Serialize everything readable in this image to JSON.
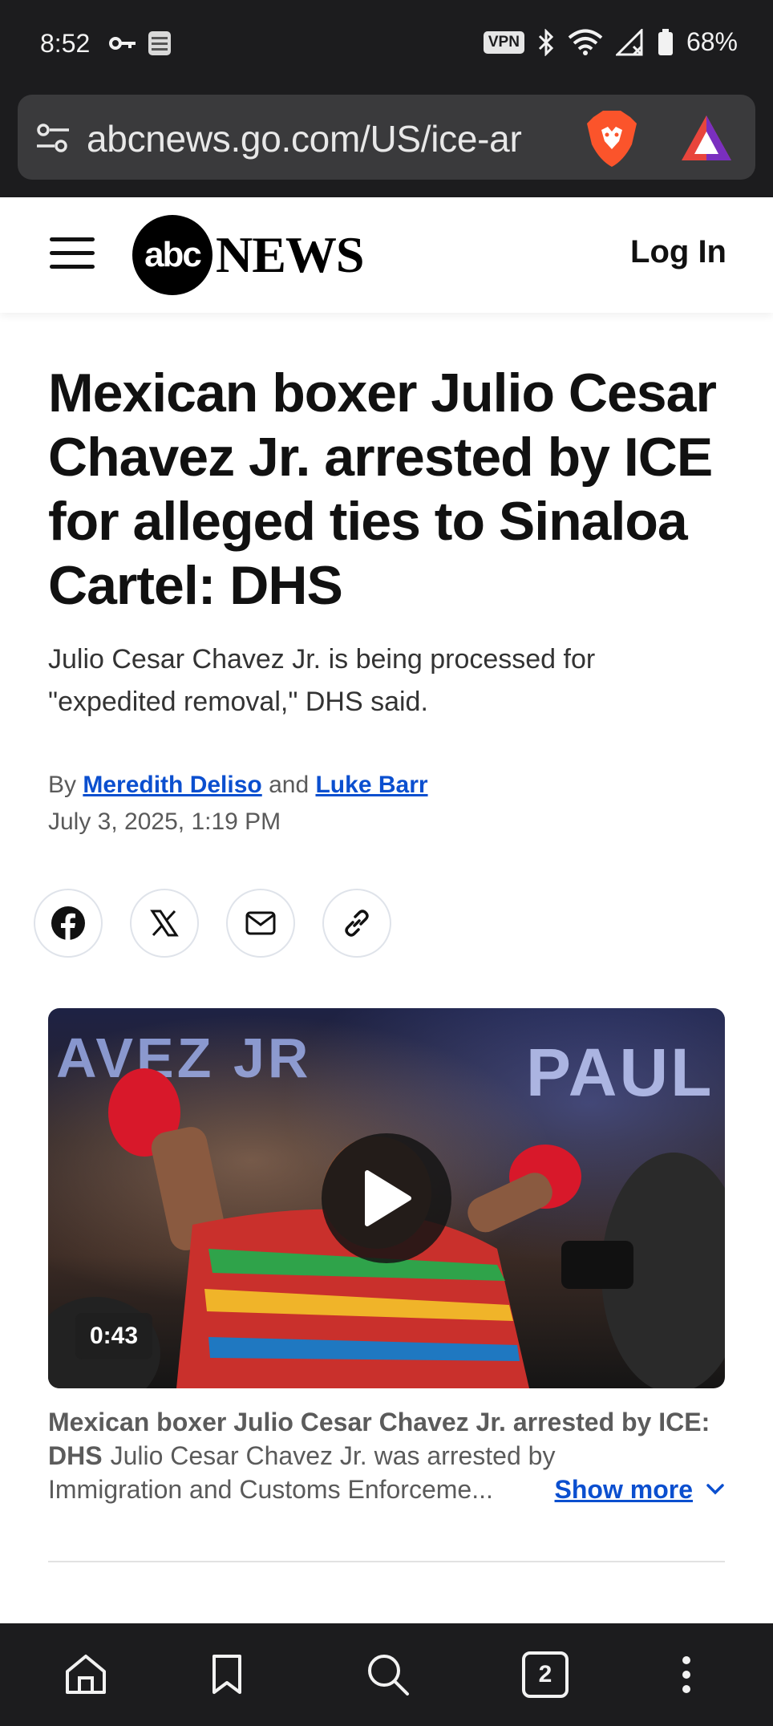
{
  "status_bar": {
    "time": "8:52",
    "vpn_label": "VPN",
    "battery": "68%",
    "icons": [
      "key-icon",
      "amazon-shopper-panel-icon",
      "bluetooth-icon",
      "wifi-icon",
      "signal-icon",
      "battery-icon"
    ]
  },
  "browser": {
    "url": "abcnews.go.com/US/ice-ar",
    "icons": [
      "site-settings-icon",
      "brave-shields-icon",
      "brave-rewards-icon"
    ],
    "tab_count": "2",
    "bottom_nav": [
      "home-icon",
      "bookmark-icon",
      "search-icon",
      "tabs-icon",
      "more-icon"
    ]
  },
  "site_header": {
    "logo_circle": "abc",
    "logo_text": "NEWS",
    "login_label": "Log In"
  },
  "article": {
    "headline": "Mexican boxer Julio Cesar Chavez Jr. arrested by ICE for alleged ties to Sinaloa Cartel: DHS",
    "dek": "Julio Cesar Chavez Jr. is being processed for \"expedited removal,\" DHS said.",
    "byline_prefix": "By",
    "author_1": "Meredith Deliso",
    "byline_conj": "and",
    "author_2": "Luke Barr",
    "date": "July 3, 2025, 1:19 PM",
    "share_icons": [
      "facebook-icon",
      "x-icon",
      "email-icon",
      "link-icon"
    ]
  },
  "video": {
    "banner_left": "AVEZ JR",
    "banner_right": "PAUL",
    "duration": "0:43",
    "caption_title": "Mexican boxer Julio Cesar Chavez Jr. arrested by ICE: DHS",
    "caption_body_1": "Julio Cesar Chavez Jr. was arrested by",
    "caption_body_2": "Immigration and Customs Enforceme...",
    "show_more": "Show more"
  },
  "colors": {
    "link_blue": "#0b4fcf",
    "chrome_dark": "#1c1c1e",
    "url_bar": "#3a3a3c"
  }
}
